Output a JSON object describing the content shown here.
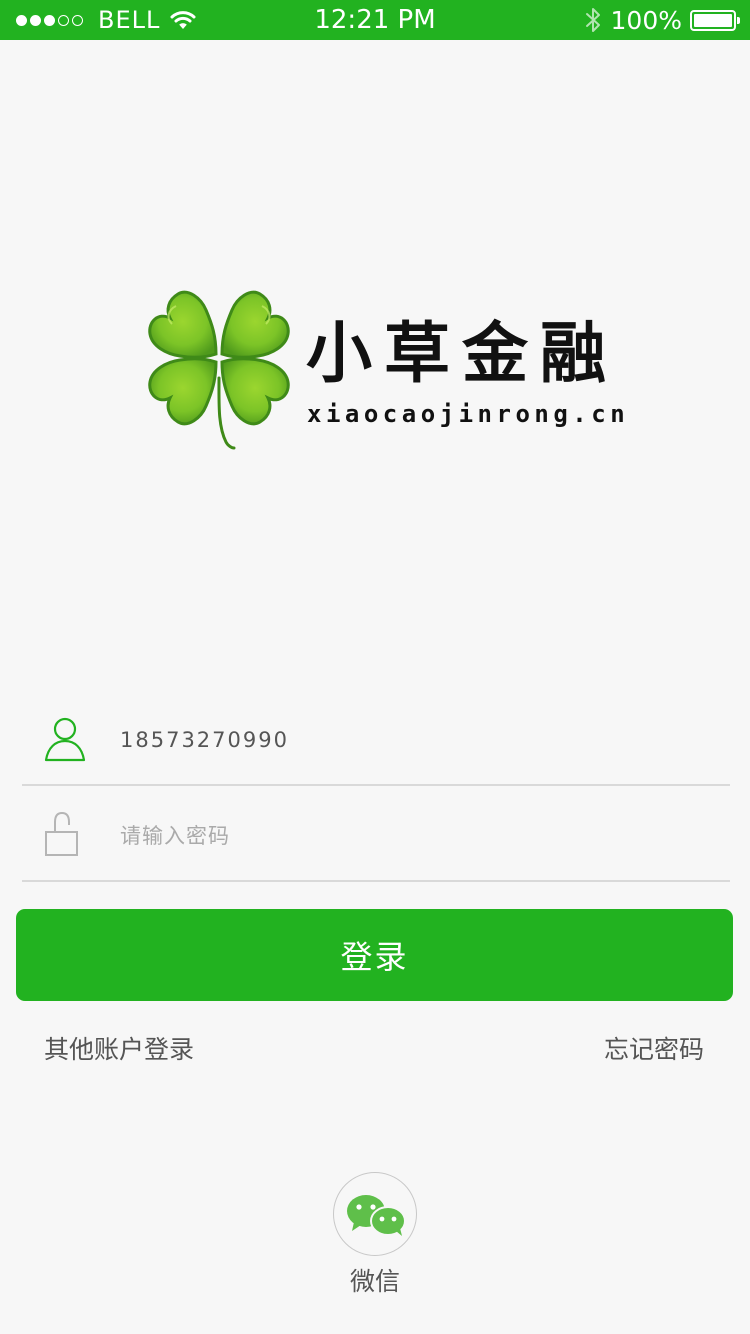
{
  "status_bar": {
    "carrier": "BELL",
    "time": "12:21 PM",
    "battery": "100%",
    "signal_bars_filled": 3,
    "signal_bars_total": 5
  },
  "brand": {
    "name": "小草金融",
    "domain": "xiaocaojinrong.cn"
  },
  "form": {
    "username_value": "18573270990",
    "password_placeholder": "请输入密码",
    "login_label": "登录"
  },
  "links": {
    "other_login": "其他账户登录",
    "forgot_password": "忘记密码"
  },
  "social": {
    "wechat_label": "微信"
  },
  "colors": {
    "accent": "#22b220",
    "background": "#f7f7f7",
    "text": "#555555",
    "divider": "#d9d9d9"
  },
  "icons": {
    "user": "user-icon",
    "password": "lock-icon",
    "wechat": "wechat-icon",
    "bluetooth": "bluetooth-icon",
    "wifi": "wifi-icon",
    "battery": "battery-icon"
  }
}
